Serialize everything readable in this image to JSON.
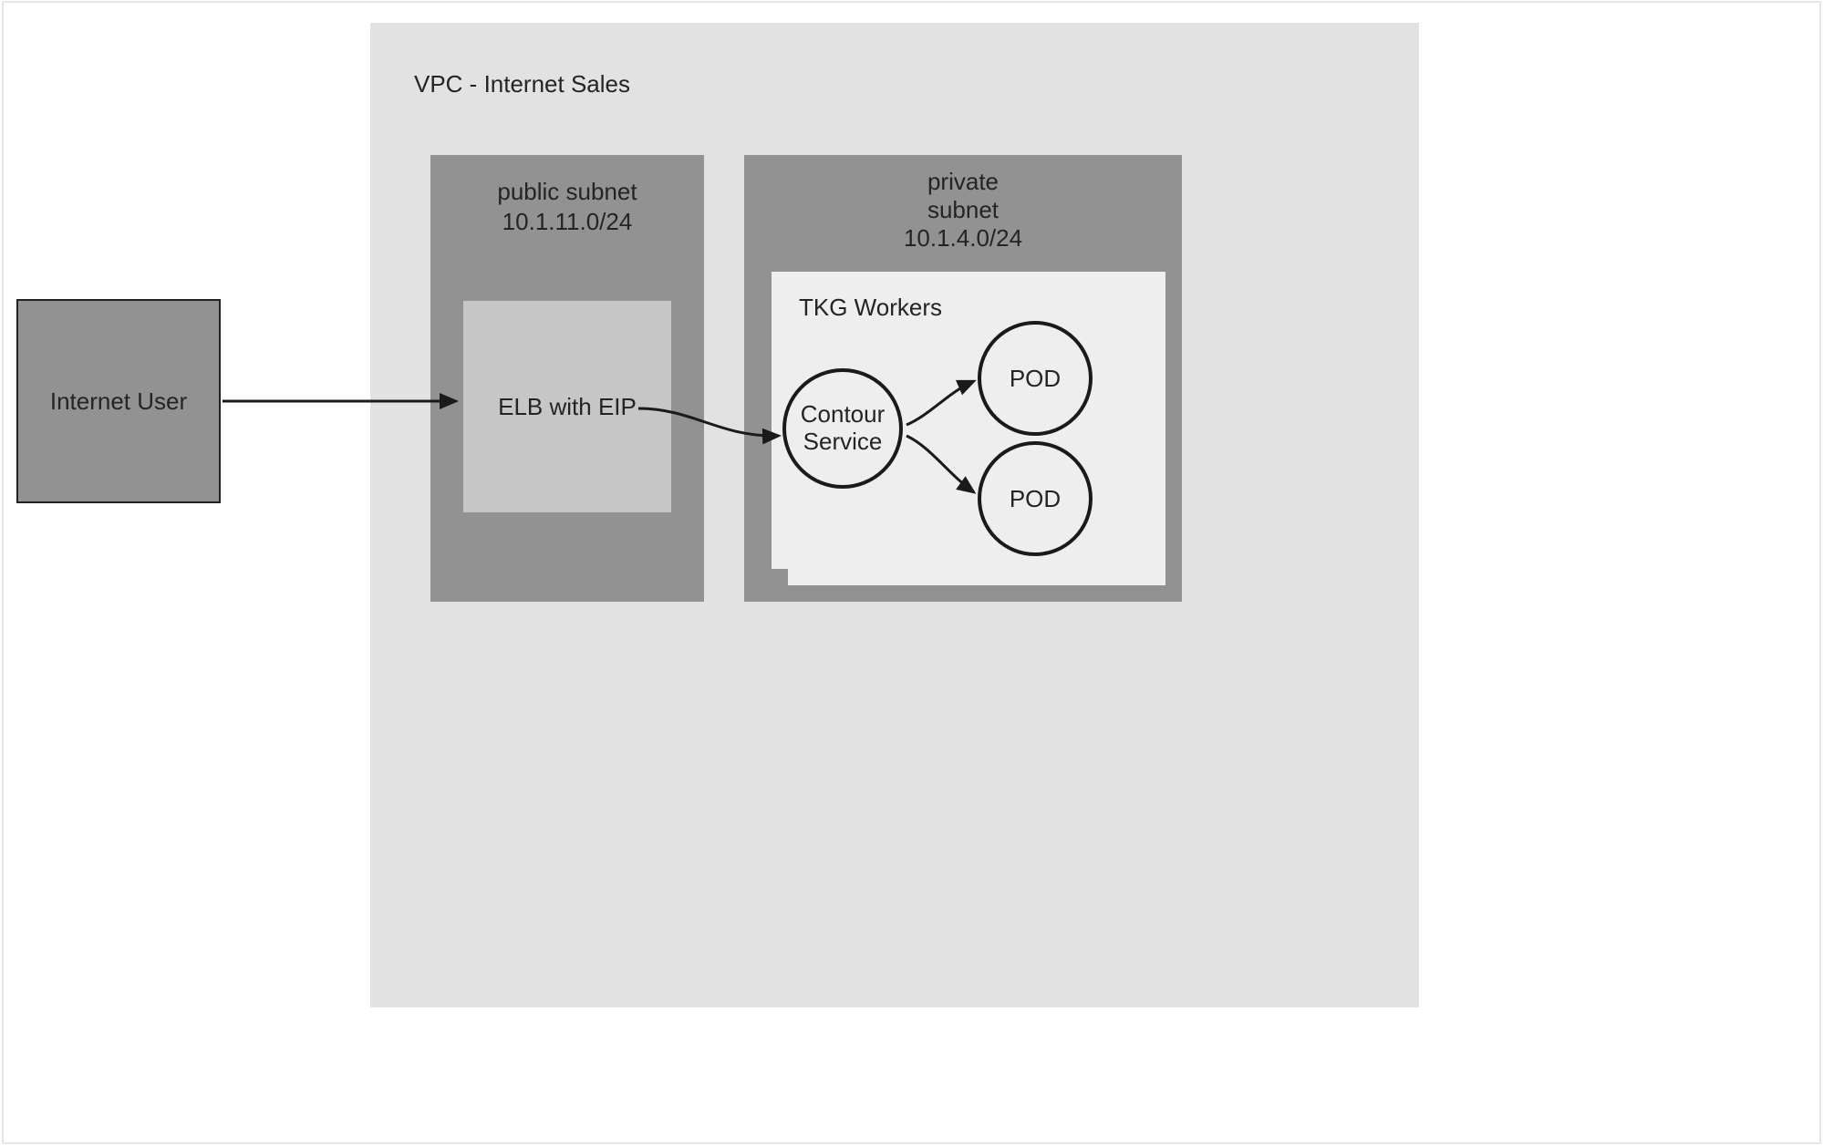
{
  "internet_user": {
    "label": "Internet User"
  },
  "vpc": {
    "title": "VPC - Internet Sales"
  },
  "public_subnet": {
    "title_line1": "public subnet",
    "title_line2": "10.1.11.0/24",
    "elb": {
      "label": "ELB with EIP"
    }
  },
  "private_subnet": {
    "title_line1": "private",
    "title_line2": "subnet",
    "title_line3": "10.1.4.0/24",
    "workers": {
      "title": "TKG Workers",
      "contour": {
        "line1": "Contour",
        "line2": "Service"
      },
      "pod1": {
        "label": "POD"
      },
      "pod2": {
        "label": "POD"
      }
    }
  }
}
